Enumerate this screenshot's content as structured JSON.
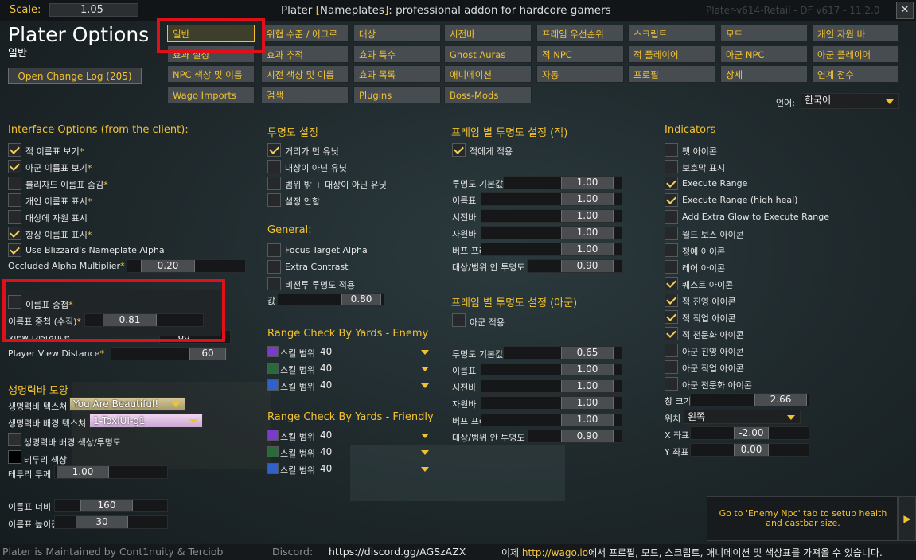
{
  "titlebar": {
    "scale_label": "Scale:",
    "scale_value": "1.05",
    "title_prefix": "Plater ",
    "title_bracket_open": "[",
    "title_mid": "Nameplates",
    "title_bracket_close": "]",
    "title_suffix": ": professional addon for hardcore gamers",
    "version": "Plater-v614-Retail - DF v617 - 11.2.0",
    "close_glyph": "✕"
  },
  "header": {
    "title": "Plater Options",
    "subtitle": "일반",
    "changelog_button": "Open Change Log (205)"
  },
  "tabs": [
    "일반",
    "위협 수준 / 어그로",
    "대상",
    "시전바",
    "프레임 우선순위",
    "스크립트",
    "모드",
    "개인 자원 바",
    "효과 설정",
    "효과 추적",
    "효과 특수",
    "Ghost Auras",
    "적 NPC",
    "적 플레이어",
    "아군 NPC",
    "아군 플레이어",
    "NPC 색상 및 이름",
    "시전 색상 및 이름",
    "효과 목록",
    "애니메이션",
    "자동",
    "프로필",
    "상세",
    "연계 점수",
    "Wago Imports",
    "검색",
    "Plugins",
    "Boss-Mods"
  ],
  "language": {
    "label": "언어:",
    "value": "한국어"
  },
  "interface": {
    "title": "Interface Options (from the client):",
    "checks": [
      {
        "label": "적 이름표 보기",
        "star": "*",
        "checked": true
      },
      {
        "label": "아군 이름표 보기",
        "star": "*",
        "checked": true
      },
      {
        "label": "블리자드 이름표 숨김",
        "star": "*",
        "checked": false
      },
      {
        "label": "개인 이름표 표시",
        "star": "*",
        "checked": false
      },
      {
        "label": "대상에 자원 표시",
        "star": "",
        "checked": false
      },
      {
        "label": "항상 이름표 표시",
        "star": "*",
        "checked": true
      },
      {
        "label": "Use Blizzard's Nameplate Alpha",
        "star": "",
        "checked": true
      }
    ],
    "occluded_label": "Occluded Alpha Multiplier",
    "occluded_star": "*",
    "occluded_value": "0.20",
    "stacking_label": "이름표 중첩",
    "stacking_star": "*",
    "vertical_label": "이름표 중첩 (수직)",
    "vertical_star": "*",
    "vertical_value": "0.81",
    "view_distance_label": "View Distance",
    "view_distance_value": "60",
    "player_view_label": "Player View Distance",
    "player_view_star": "*",
    "player_view_value": "60"
  },
  "health": {
    "title": "생명력바 모양",
    "texture_label": "생명력바 텍스쳐",
    "texture_value": "You Are Beautiful!",
    "bg_texture_label": "생명력바 배경 텍스쳐",
    "bg_texture_value": "1-ToxiUI-g1",
    "bg_color_label": "생명력바 배경 색상/투명도",
    "border_color_label": "테두리 색상",
    "border_size_label": "테두리 두께",
    "border_size_value": "1.00",
    "width_label": "이름표 너비",
    "width_value": "160",
    "height_label": "이름표 높이값",
    "height_value": "30"
  },
  "transparency": {
    "title": "투명도 설정",
    "checks": [
      {
        "label": "거리가 먼 유닛",
        "checked": true
      },
      {
        "label": "대상이 아닌 유닛",
        "checked": false
      },
      {
        "label": "범위 밖 + 대상이 아닌 유닛",
        "checked": false
      },
      {
        "label": "설정 안함",
        "checked": false
      }
    ],
    "general_title": "General:",
    "general_checks": [
      {
        "label": "Focus Target Alpha",
        "checked": false
      },
      {
        "label": "Extra Contrast",
        "checked": false
      },
      {
        "label": "비전투 투명도 적용",
        "checked": false
      }
    ],
    "value_label": "값",
    "value": "0.80"
  },
  "range_enemy": {
    "title": "Range Check By Yards - Enemy",
    "rows": [
      {
        "label": "스킬 범위",
        "value": "40"
      },
      {
        "label": "스킬 범위",
        "value": "40"
      },
      {
        "label": "스킬 범위",
        "value": "40"
      }
    ]
  },
  "range_friendly": {
    "title": "Range Check By Yards - Friendly",
    "rows": [
      {
        "label": "스킬 범위",
        "value": "40"
      },
      {
        "label": "스킬 범위",
        "value": "40"
      },
      {
        "label": "스킬 범위",
        "value": "40"
      }
    ]
  },
  "frame_enemy": {
    "title": "프레임 별 투명도 설정 (적)",
    "apply_label": "적에게 적용",
    "apply_checked": true,
    "rows": [
      {
        "label": "투명도 기본값",
        "value": "1.00"
      },
      {
        "label": "이름표",
        "value": "1.00"
      },
      {
        "label": "시전바",
        "value": "1.00"
      },
      {
        "label": "자원바",
        "value": "1.00"
      },
      {
        "label": "버프 프레임",
        "value": "1.00"
      },
      {
        "label": "대상/범위 안 투명도",
        "value": "0.90"
      }
    ]
  },
  "frame_friendly": {
    "title": "프레임 별 투명도 설정 (아군)",
    "apply_label": "아군 적용",
    "apply_checked": false,
    "rows": [
      {
        "label": "투명도 기본값",
        "value": "0.65"
      },
      {
        "label": "이름표",
        "value": "1.00"
      },
      {
        "label": "시전바",
        "value": "1.00"
      },
      {
        "label": "자원바",
        "value": "1.00"
      },
      {
        "label": "버프 프레임",
        "value": "1.00"
      },
      {
        "label": "대상/범위 안 투명도",
        "value": "0.90"
      }
    ]
  },
  "indicators": {
    "title": "Indicators",
    "checks": [
      {
        "label": "펫 아이콘",
        "checked": false
      },
      {
        "label": "보호막 표시",
        "checked": false
      },
      {
        "label": "Execute Range",
        "checked": true
      },
      {
        "label": "Execute Range (high heal)",
        "checked": true
      },
      {
        "label": "Add Extra Glow to Execute Range",
        "checked": false
      },
      {
        "label": "월드 보스 아이콘",
        "checked": false
      },
      {
        "label": "정예 아이콘",
        "checked": false
      },
      {
        "label": "레어 아이콘",
        "checked": false
      },
      {
        "label": "퀘스트 아이콘",
        "checked": true
      },
      {
        "label": "적 진영 아이콘",
        "checked": true
      },
      {
        "label": "적 직업 아이콘",
        "checked": true
      },
      {
        "label": "적 전문화 아이콘",
        "checked": true
      },
      {
        "label": "아군 진영 아이콘",
        "checked": false
      },
      {
        "label": "아군 직업 아이콘",
        "checked": false
      },
      {
        "label": "아군 전문화 아이콘",
        "checked": false
      }
    ],
    "size_label": "창 크기",
    "size_value": "2.66",
    "anchor_label": "위치",
    "anchor_value": "왼쪽",
    "x_label": "X 좌표",
    "x_value": "-2.00",
    "y_label": "Y 좌표",
    "y_value": "0.00"
  },
  "tip": {
    "text": "Go to 'Enemy Npc' tab to setup health and castbar size.",
    "arrow": "▶"
  },
  "footer": {
    "maintainer": "Plater is Maintained by Cont1nuity & Terciob",
    "discord_label": "Discord:",
    "discord_url": "https://discord.gg/AGSzAZX",
    "wago_prefix": "이제 ",
    "wago_url": "http://wago.io",
    "wago_suffix": "에서 프로필, 모드, 스크립트, 애니메이션 및 색상표를 가져올 수 있습니다."
  },
  "colors": {
    "accent": "#f2c230",
    "highlight": "#e0101a"
  }
}
